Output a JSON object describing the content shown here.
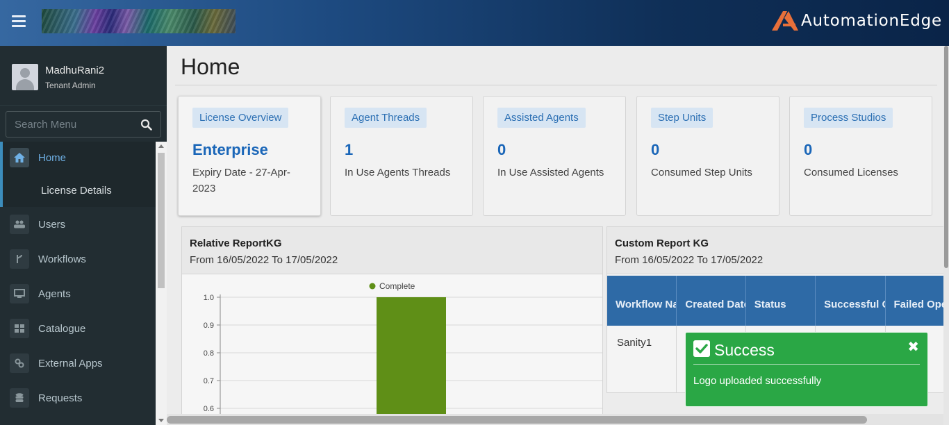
{
  "brand": {
    "name": "AutomationEdge",
    "color": "#e8703a"
  },
  "user": {
    "name": "MadhuRani2",
    "role": "Tenant Admin"
  },
  "search": {
    "placeholder": "Search Menu"
  },
  "menu": {
    "items": [
      {
        "label": "Home",
        "icon": "home-icon",
        "active": true
      },
      {
        "label": "Users",
        "icon": "users-icon"
      },
      {
        "label": "Workflows",
        "icon": "workflow-icon"
      },
      {
        "label": "Agents",
        "icon": "monitor-icon"
      },
      {
        "label": "Catalogue",
        "icon": "grid-icon"
      },
      {
        "label": "External Apps",
        "icon": "link-icon"
      },
      {
        "label": "Requests",
        "icon": "database-icon"
      }
    ],
    "subitem": "License Details"
  },
  "page": {
    "title": "Home"
  },
  "cards": [
    {
      "tag": "License Overview",
      "value": "Enterprise",
      "desc": "Expiry Date - 27-Apr-2023"
    },
    {
      "tag": "Agent Threads",
      "value": "1",
      "desc": "In Use Agents Threads"
    },
    {
      "tag": "Assisted Agents",
      "value": "0",
      "desc": "In Use Assisted Agents"
    },
    {
      "tag": "Step Units",
      "value": "0",
      "desc": "Consumed Step Units"
    },
    {
      "tag": "Process Studios",
      "value": "0",
      "desc": "Consumed Licenses"
    }
  ],
  "relative_report": {
    "title": "Relative ReportKG",
    "range": "From 16/05/2022 To 17/05/2022"
  },
  "custom_report": {
    "title": "Custom Report KG",
    "range": "From 16/05/2022 To 17/05/2022",
    "columns": [
      "Workflow Name",
      "Created Date",
      "Status",
      "Successful Operations",
      "Failed Operations"
    ],
    "rows": [
      [
        "Sanity1",
        "",
        "",
        "",
        ""
      ]
    ]
  },
  "chart_data": {
    "type": "bar",
    "legend": "Complete",
    "series": [
      {
        "name": "Complete",
        "values": [
          1.0
        ],
        "color": "#5f8f17"
      }
    ],
    "categories": [
      ""
    ],
    "yticks": [
      "0.6",
      "0.7",
      "0.8",
      "0.9",
      "1.0"
    ],
    "ylim": [
      0.6,
      1.0
    ],
    "legend_position": "top-center"
  },
  "toast": {
    "title": "Success",
    "message": "Logo uploaded successfully",
    "close": "✖",
    "color": "#2aa745"
  }
}
